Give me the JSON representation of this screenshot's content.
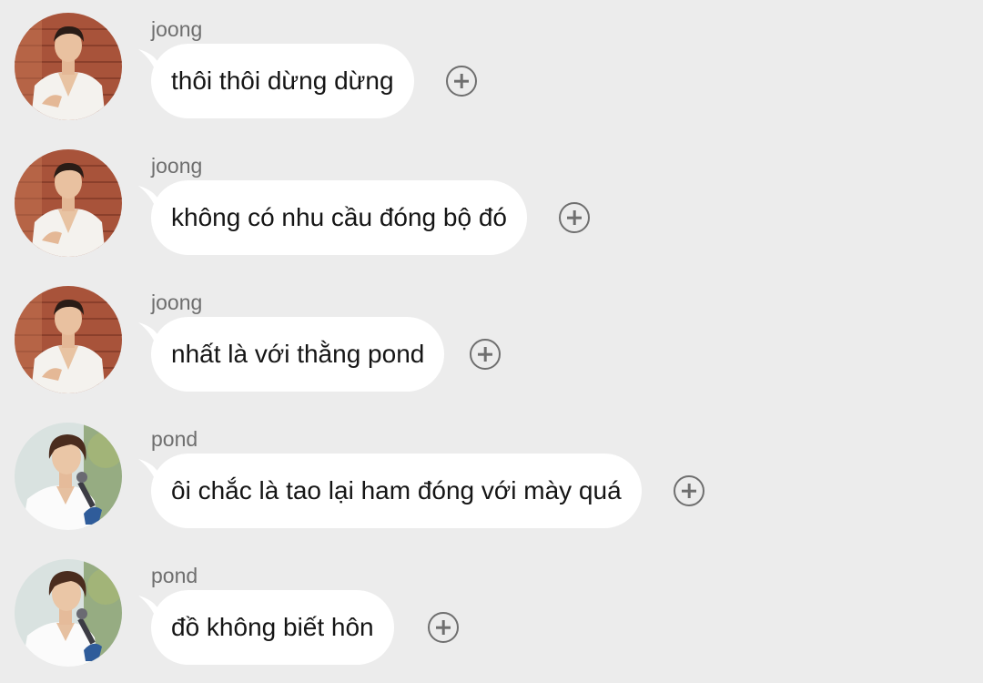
{
  "messages": [
    {
      "sender": "joong",
      "text": "thôi thôi dừng dừng",
      "avatar": "joong-avatar"
    },
    {
      "sender": "joong",
      "text": "không có nhu cầu đóng bộ đó",
      "avatar": "joong-avatar"
    },
    {
      "sender": "joong",
      "text": "nhất là với thằng pond",
      "avatar": "joong-avatar"
    },
    {
      "sender": "pond",
      "text": "ôi chắc là tao lại ham đóng với mày quá",
      "avatar": "pond-avatar"
    },
    {
      "sender": "pond",
      "text": "đồ không biết hôn",
      "avatar": "pond-avatar"
    }
  ],
  "icons": {
    "react": "add-reaction-icon"
  },
  "colors": {
    "background": "#ececec",
    "bubble": "#ffffff",
    "sender_text": "#6e6e6e",
    "message_text": "#151515"
  }
}
